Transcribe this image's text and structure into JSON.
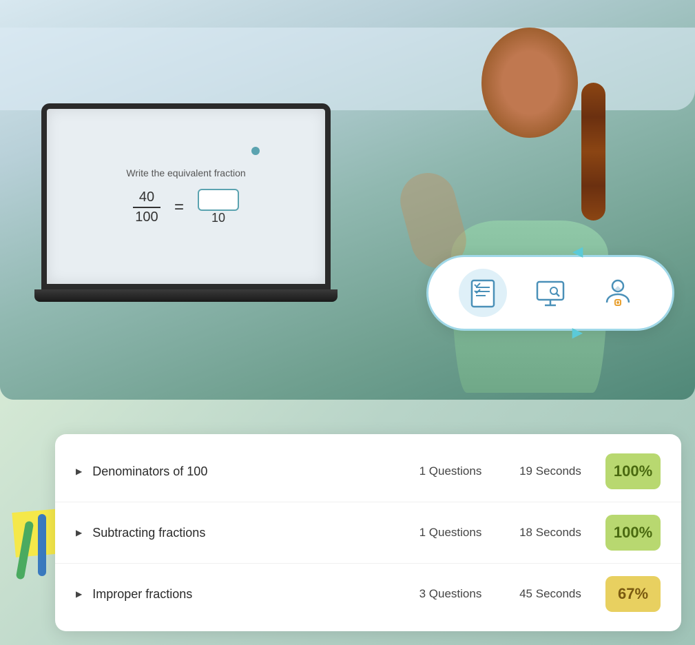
{
  "background": {
    "color_top": "#c8dce8",
    "color_bottom": "#a8c8b8"
  },
  "laptop": {
    "question_text": "Write the equivalent fraction",
    "numerator": "40",
    "denominator": "100",
    "equals": "=",
    "answer_denominator": "10"
  },
  "icon_pill": {
    "icons": [
      {
        "name": "checklist-icon",
        "label": "Quiz",
        "active": true
      },
      {
        "name": "screen-icon",
        "label": "Screen",
        "active": false
      },
      {
        "name": "student-icon",
        "label": "Student",
        "active": false
      }
    ],
    "arrow_top": "▶",
    "arrow_bottom": "▶"
  },
  "table": {
    "rows": [
      {
        "title": "Denominators of 100",
        "questions": "1 Questions",
        "time": "19 Seconds",
        "score": "100%",
        "score_type": "green"
      },
      {
        "title": "Subtracting fractions",
        "questions": "1 Questions",
        "time": "18 Seconds",
        "score": "100%",
        "score_type": "green"
      },
      {
        "title": "Improper fractions",
        "questions": "3 Questions",
        "time": "45 Seconds",
        "score": "67%",
        "score_type": "yellow"
      }
    ]
  }
}
